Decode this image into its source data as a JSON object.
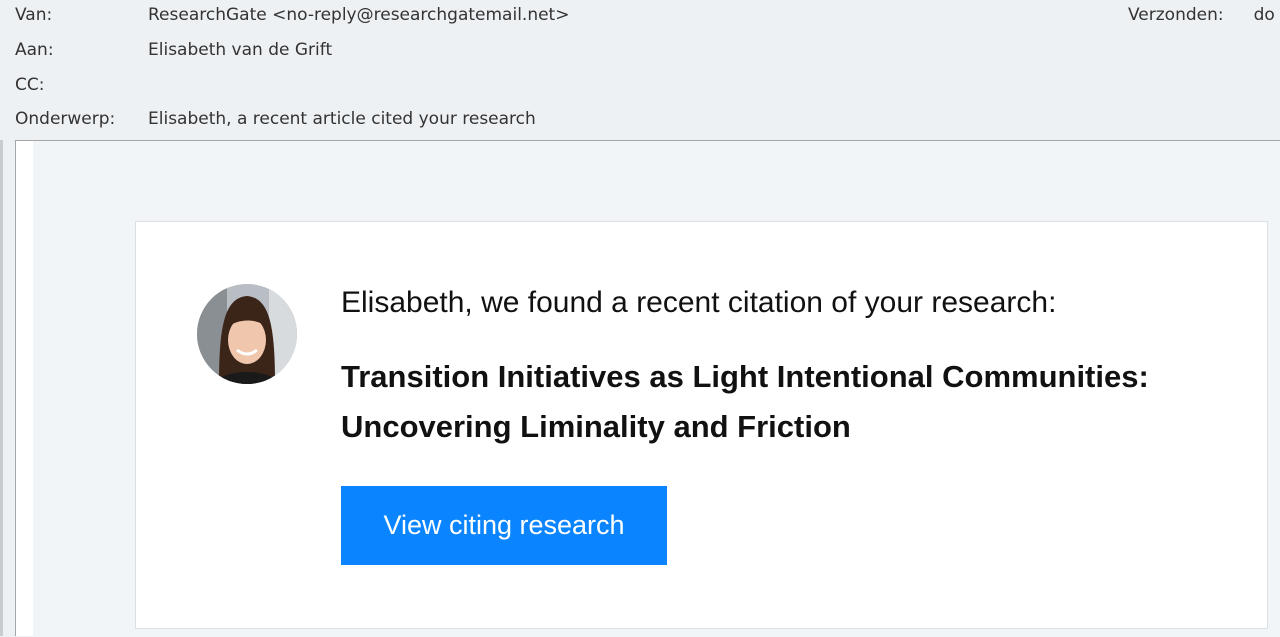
{
  "header": {
    "from_label": "Van:",
    "from_value": "ResearchGate <no-reply@researchgatemail.net>",
    "to_label": "Aan:",
    "to_value": "Elisabeth van de Grift",
    "cc_label": "CC:",
    "cc_value": "",
    "subject_label": "Onderwerp:",
    "subject_value": "Elisabeth, a recent article cited your research",
    "sent_label": "Verzonden:",
    "sent_value": "do"
  },
  "email": {
    "headline": "Elisabeth, we found a recent citation of your research:",
    "article_title": "Transition Initiatives as Light Intentional Communities: Uncovering Liminality and Friction",
    "cta_label": "View citing research"
  },
  "colors": {
    "cta_background": "#0a85ff",
    "header_background": "#eef1f4",
    "body_background": "#f2f5f8"
  }
}
